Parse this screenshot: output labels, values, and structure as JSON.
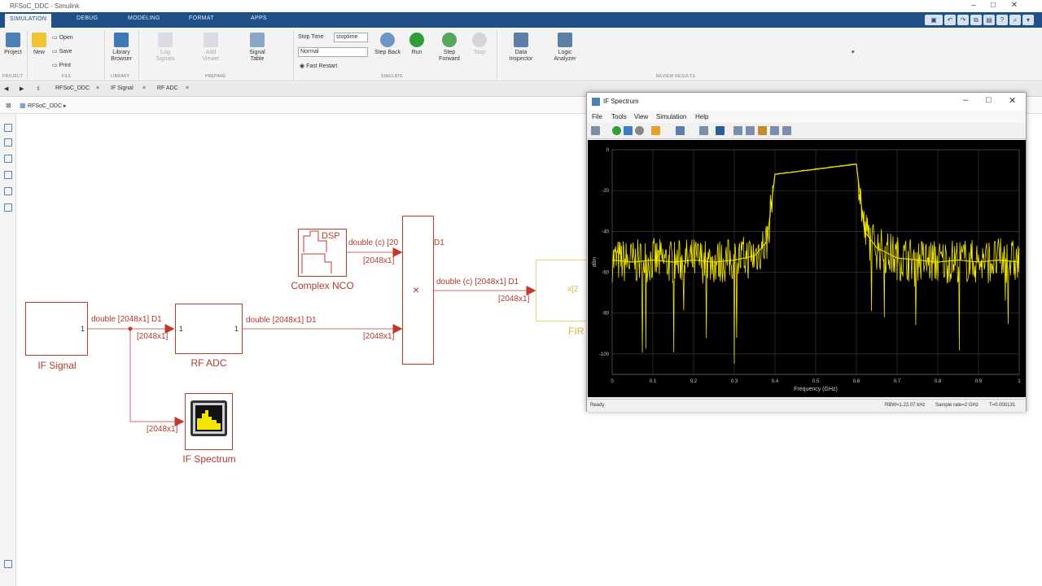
{
  "window": {
    "title": "RFSoC_DDC - Simulink"
  },
  "ribbon_tabs": [
    "SIMULATION",
    "DEBUG",
    "MODELING",
    "FORMAT",
    "APPS"
  ],
  "ribbon": {
    "project": "Project",
    "new": "New",
    "open": "Open",
    "save": "Save",
    "print": "Print",
    "library_browser": "Library Browser",
    "log_signals": "Log Signals",
    "add_viewer": "Add Viewer",
    "signal_table": "Signal Table",
    "stop_time_label": "Stop Time",
    "stop_time_value": "stoptime",
    "mode_value": "Normal",
    "fast_restart": "Fast Restart",
    "step_back": "Step Back",
    "run": "Run",
    "step_forward": "Step Forward",
    "stop": "Stop",
    "data_inspector": "Data Inspector",
    "logic_analyzer": "Logic Analyzer",
    "groups": [
      "PROJECT",
      "FILE",
      "LIBRARY",
      "PREPARE",
      "SIMULATE",
      "REVIEW RESULTS"
    ]
  },
  "doc_tabs": [
    "RFSoC_DDC",
    "IF Signal",
    "RF ADC"
  ],
  "breadcrumb": "RFSoC_DDC",
  "blocks": {
    "if_signal": "IF Signal",
    "rf_adc": "RF ADC",
    "complex_nco": "Complex NCO",
    "nco_icon_text": "DSP",
    "product_symbol": "×",
    "if_spectrum": "IF Spectrum",
    "fir_label": "FIR",
    "fir_icon_text": "x[2"
  },
  "signals": {
    "if_out": "double [2048x1] D1",
    "if_dim": "[2048x1]",
    "adc_out": "double [2048x1] D1",
    "adc_dim": "[2048x1]",
    "nco_out": "double (c) [20",
    "nco_out_tail": "D1",
    "nco_dim": "[2048x1]",
    "mult_out": "double (c) [2048x1] D1",
    "mult_dim": "[2048x1]",
    "spectrum_dim": "[2048x1]",
    "port_one": "1"
  },
  "scope": {
    "title": "IF Spectrum",
    "menu": [
      "File",
      "Tools",
      "View",
      "Simulation",
      "Help"
    ],
    "status_ready": "Ready",
    "status_rbw": "RBW=1.22.07 kHz",
    "status_sample_rate": "Sample rate=2 GHz",
    "status_time": "T=0.000131"
  },
  "chart_data": {
    "type": "line",
    "title": "",
    "xlabel": "Frequency (GHz)",
    "ylabel": "dBm",
    "xlim": [
      0,
      1
    ],
    "ylim": [
      -110,
      0
    ],
    "x_ticks": [
      "0",
      "0.1",
      "0.2",
      "0.3",
      "0.4",
      "0.5",
      "0.6",
      "0.7",
      "0.8",
      "0.9",
      "1"
    ],
    "y_ticks": [
      "0",
      "-20",
      "-40",
      "-60",
      "-80",
      "-100"
    ],
    "grid": true,
    "series": [
      {
        "color": "#f2e600",
        "x": [
          0,
          0.05,
          0.1,
          0.15,
          0.2,
          0.25,
          0.3,
          0.35,
          0.38,
          0.4,
          0.6,
          0.62,
          0.65,
          0.7,
          0.75,
          0.8,
          0.85,
          0.9,
          0.95,
          1
        ],
        "y": [
          -54,
          -55,
          -54,
          -55,
          -54,
          -55,
          -54,
          -52,
          -45,
          -12,
          -7,
          -40,
          -48,
          -53,
          -54,
          -55,
          -54,
          -55,
          -54,
          -55
        ]
      }
    ]
  },
  "colors": {
    "ribbon_blue": "#1e4f86",
    "block_red": "#c0392b",
    "trace_yellow": "#f2e600"
  }
}
